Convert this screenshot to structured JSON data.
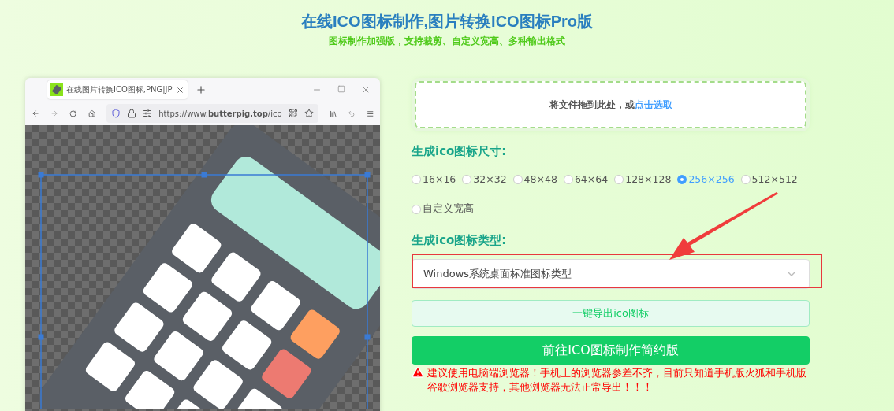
{
  "header": {
    "title": "在线ICO图标制作,图片转换ICO图标Pro版",
    "subtitle": "图标制作加强版，支持裁剪、自定义宽高、多种输出格式"
  },
  "preview": {
    "tab_title": "在线图片转换ICO图标,PNG|JP",
    "url": "https://www.**butterpig.top**/ico"
  },
  "upload": {
    "text": "将文件拖到此处，或",
    "link": "点击选取"
  },
  "size_label": "生成ico图标尺寸:",
  "sizes": [
    {
      "label": "16×16",
      "selected": false
    },
    {
      "label": "32×32",
      "selected": false
    },
    {
      "label": "48×48",
      "selected": false
    },
    {
      "label": "64×64",
      "selected": false
    },
    {
      "label": "128×128",
      "selected": false
    },
    {
      "label": "256×256",
      "selected": true
    },
    {
      "label": "512×512",
      "selected": false
    },
    {
      "label": "自定义宽高",
      "selected": false
    }
  ],
  "type_label": "生成ico图标类型:",
  "type_select": {
    "value": "Windows系统桌面标准图标类型"
  },
  "export_button": "一键导出ico图标",
  "simple_button": "前往ICO图标制作简约版",
  "warning": "建议使用电脑端浏览器！手机上的浏览器参差不齐，目前只知道手机版火狐和手机版谷歌浏览器支持，其他浏览器无法正常导出！！！"
}
